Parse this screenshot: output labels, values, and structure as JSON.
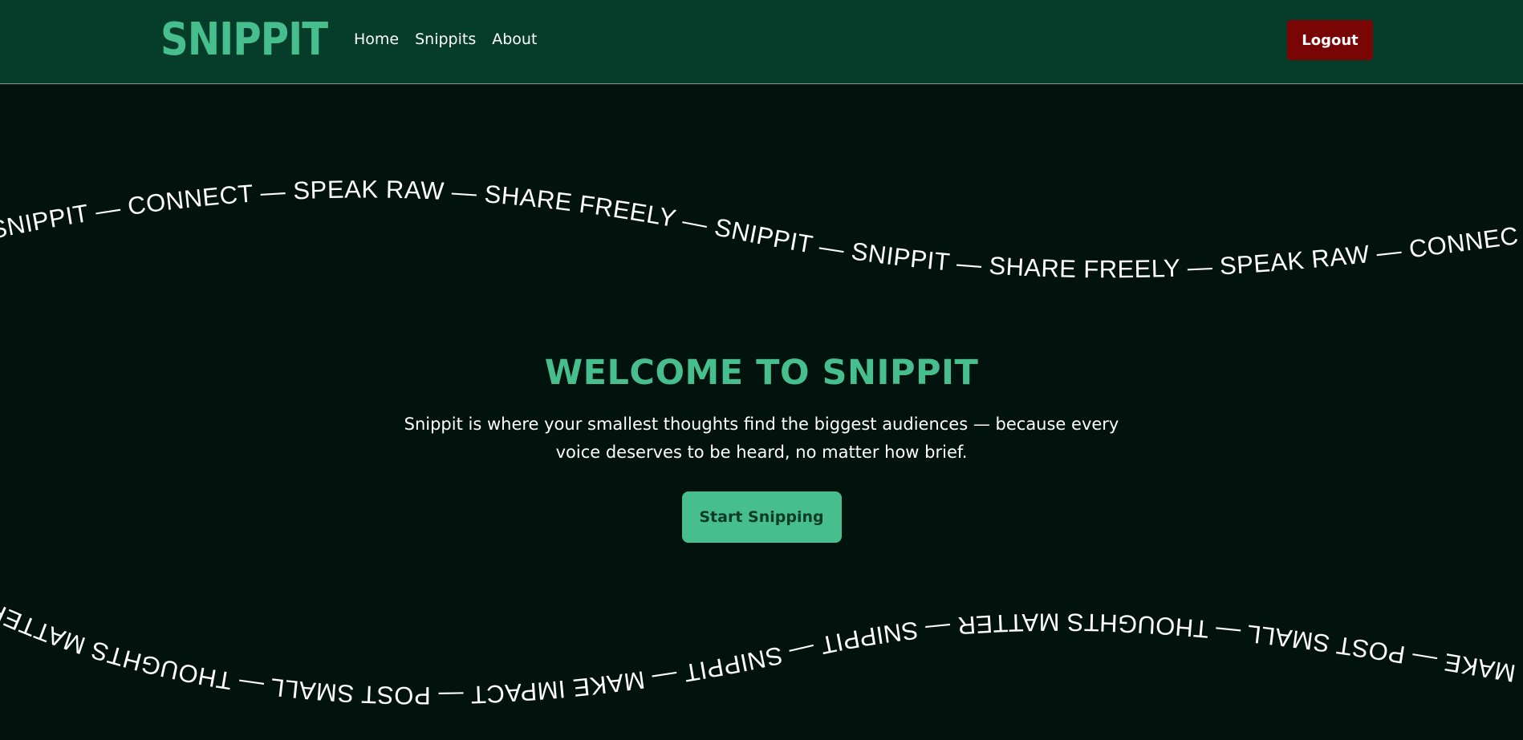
{
  "nav": {
    "logo_text": "SNIPPIT",
    "links": [
      "Home",
      "Snippits",
      "About"
    ],
    "logout_label": "Logout"
  },
  "marquee": {
    "top_text": "SNIPPIT — CONNECT — SPEAK RAW — SHARE FREELY — SNIPPIT — SNIPPIT — SHARE FREELY — SPEAK RAW — CONNEC",
    "bottom_text": "MAKE — POST SMALL — THOUGHTS MATTER — SNIPPIT — SNIPPIT — MAKE IMPACT — POST SMALL — THOUGHTS MATTER — THOUGHTS MATTER"
  },
  "hero": {
    "title": "WELCOME TO SNIPPIT",
    "description": "Snippit is where your smallest thoughts find the biggest audiences — because every voice deserves to be heard, no matter how brief.",
    "cta_label": "Start Snipping"
  },
  "colors": {
    "nav_bg": "#063d2a",
    "page_bg": "#02130e",
    "accent": "#47be8d",
    "logout_bg": "#7a0505"
  }
}
